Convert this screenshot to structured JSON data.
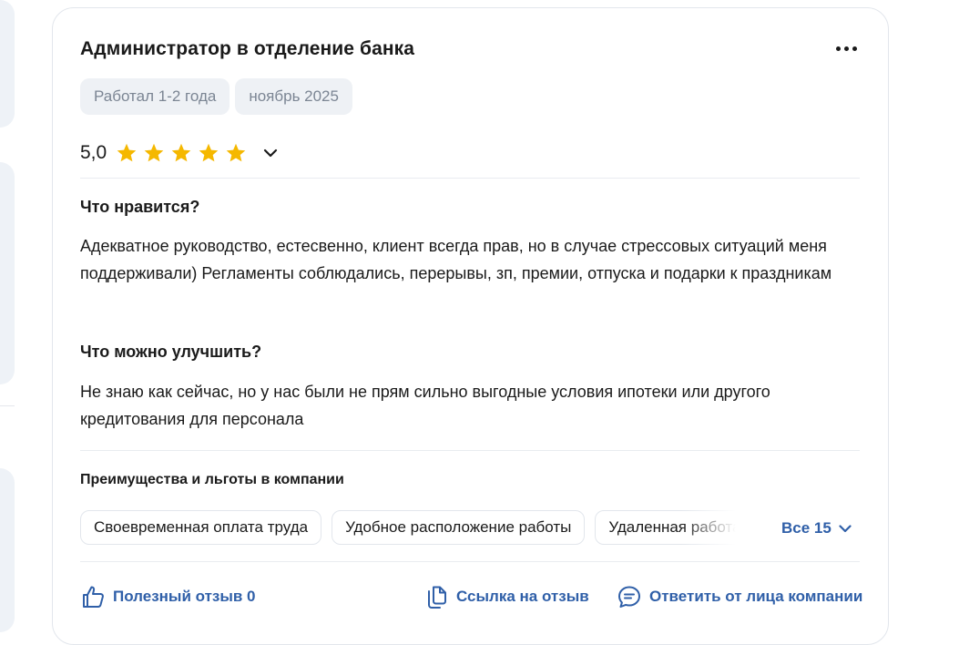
{
  "review": {
    "title": "Администратор в отделение банка",
    "tags": [
      "Работал 1-2 года",
      "ноябрь 2025"
    ],
    "rating": {
      "value": "5,0",
      "stars": 5,
      "star_color": "#f5b800"
    },
    "pros": {
      "heading": "Что нравится?",
      "text": "Адекватное руководство, естесвенно, клиент всегда прав, но в случае стрессовых ситуаций меня поддерживали) Регламенты соблюдались, перерывы, зп, премии, отпуска и подарки к праздникам"
    },
    "cons": {
      "heading": "Что можно улучшить?",
      "text": "Не знаю как сейчас, но у нас были не прям сильно выгодные условия ипотеки или другого кредитования для персонала"
    },
    "benefits": {
      "heading": "Преимущества и льготы в компании",
      "chips": [
        "Своевременная оплата труда",
        "Удобное расположение работы",
        "Удаленная работа"
      ],
      "all_label": "Все 15"
    },
    "actions": {
      "helpful": "Полезный отзыв 0",
      "link": "Ссылка на отзыв",
      "reply": "Ответить от лица компании"
    }
  },
  "colors": {
    "accent": "#2f5fa8",
    "tag_bg": "#eef1f5",
    "tag_text": "#7b8593"
  },
  "icons": [
    "more-dots-icon",
    "star-icon",
    "chevron-down-icon",
    "thumbs-up-icon",
    "copy-link-icon",
    "chat-bubble-icon"
  ]
}
